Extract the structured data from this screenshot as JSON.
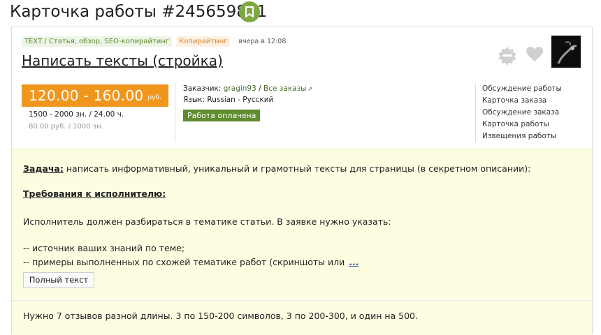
{
  "header": {
    "title": "Карточка работы #245659881",
    "bookmark_icon": "bookmark-icon",
    "accent_color": "#7fa843"
  },
  "card": {
    "tags": [
      {
        "label": "TEXT / Статья, обзор, SEO-копирайтинг"
      },
      {
        "label": "Копирайтинг"
      }
    ],
    "date": "вчера в 12:08",
    "job_title": "Написать тексты (стройка)",
    "icons": [
      "star-badge-icon",
      "heart-icon"
    ],
    "price": {
      "range": "120.00 - 160.00",
      "currency": "руб.",
      "volume": "1500 - 2000 зн.  / 24.00 ч.",
      "rate": "80.00 руб. / 1000 зн.",
      "color": "#f1961d"
    },
    "customer": {
      "label": "Заказчик:",
      "name": "gragin93",
      "separator": "/",
      "all_orders": "Все заказы",
      "ext_icon": "external-link-icon"
    },
    "language": {
      "label": "Язык:",
      "value": "Russian - Русский"
    },
    "status_badge": "Работа оплачена",
    "side_links": [
      "Обсуждение работы",
      "Карточка заказа",
      "Обсуждение заказа",
      "Карточка работы",
      "Извещения работы"
    ]
  },
  "description": {
    "task_label": "Задача:",
    "task_text": "написать информативный, уникальный и грамотный тексты для страницы (в секретном описании):",
    "req_heading": "Требования к исполнителю:",
    "para1": "Исполнитель должен разбираться в тематике статьи. В заявке нужно указать:",
    "item1": "-- источник ваших знаний по теме;",
    "item2": "-- примеры выполненных по схожей тематике работ (скриншоты или",
    "more": "...",
    "full_button": "Полный текст"
  },
  "reviews": {
    "text": "Нужно 7 отзывов разной длины. 3 по 150-200 символов, 3 по 200-300, и один на 500."
  }
}
